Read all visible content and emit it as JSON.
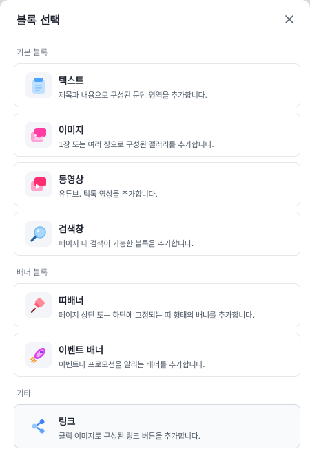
{
  "modal": {
    "title": "블록 선택",
    "close_icon": "close-icon"
  },
  "sections": [
    {
      "label": "기본 블록",
      "items": [
        {
          "title": "텍스트",
          "description": "제목과 내용으로 구성된 문단 영역을 추가합니다.",
          "icon": "document-icon"
        },
        {
          "title": "이미지",
          "description": "1장 또는 여러 장으로 구성된 갤러리를 추가합니다.",
          "icon": "image-gallery-icon"
        },
        {
          "title": "동영상",
          "description": "유튜브, 틱톡 영상을 추가합니다.",
          "icon": "video-icon"
        },
        {
          "title": "검색창",
          "description": "페이지 내 검색이 가능한 블록을 추가합니다.",
          "icon": "magnifier-icon"
        }
      ]
    },
    {
      "label": "배너 블록",
      "items": [
        {
          "title": "띠배너",
          "description": "페이지 상단 또는 하단에 고정되는 띠 형태의 배너를 추가합니다.",
          "icon": "pin-icon"
        },
        {
          "title": "이벤트 배너",
          "description": "이벤트나 프로모션을 알리는 배너를 추가합니다.",
          "icon": "rocket-icon"
        }
      ]
    },
    {
      "label": "기타",
      "items": [
        {
          "title": "링크",
          "description": "클릭 이미지로 구성된 링크 버튼을 추가합니다.",
          "icon": "share-link-icon"
        }
      ]
    }
  ],
  "colors": {
    "title_text": "#1f2430",
    "section_label": "#6b7280",
    "border": "#e5e7eb",
    "active_card_bg": "#f8fafc"
  }
}
